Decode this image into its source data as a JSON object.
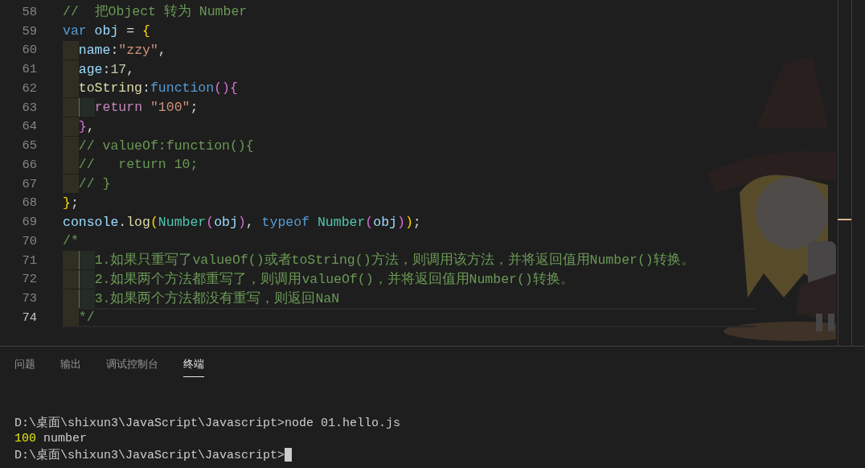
{
  "editor": {
    "lines": [
      {
        "number": "58",
        "current": false,
        "tokens": [
          {
            "kind": "comment",
            "text": "//  把Object 转为 Number"
          }
        ]
      },
      {
        "number": "59",
        "current": false,
        "tokens": [
          {
            "kind": "keyword",
            "text": "var"
          },
          {
            "kind": "variable",
            "text": " obj"
          },
          {
            "kind": "plain",
            "text": " = "
          },
          {
            "kind": "bracket1",
            "text": "{"
          }
        ]
      },
      {
        "number": "60",
        "current": false,
        "tokens": [
          {
            "kind": "variable",
            "text": "  name"
          },
          {
            "kind": "plain",
            "text": ":"
          },
          {
            "kind": "string",
            "text": "\"zzy\""
          },
          {
            "kind": "plain",
            "text": ","
          }
        ]
      },
      {
        "number": "61",
        "current": false,
        "tokens": [
          {
            "kind": "variable",
            "text": "  age"
          },
          {
            "kind": "plain",
            "text": ":"
          },
          {
            "kind": "number",
            "text": "17"
          },
          {
            "kind": "plain",
            "text": ","
          }
        ]
      },
      {
        "number": "62",
        "current": false,
        "tokens": [
          {
            "kind": "function",
            "text": "  toString"
          },
          {
            "kind": "plain",
            "text": ":"
          },
          {
            "kind": "keyword",
            "text": "function"
          },
          {
            "kind": "bracket2",
            "text": "(){"
          }
        ]
      },
      {
        "number": "63",
        "current": false,
        "tokens": [
          {
            "kind": "control",
            "text": "    return "
          },
          {
            "kind": "string",
            "text": "\"100\""
          },
          {
            "kind": "plain",
            "text": ";"
          }
        ]
      },
      {
        "number": "64",
        "current": false,
        "tokens": [
          {
            "kind": "bracket2",
            "text": "  }"
          },
          {
            "kind": "plain",
            "text": ","
          }
        ]
      },
      {
        "number": "65",
        "current": false,
        "tokens": [
          {
            "kind": "comment",
            "text": "  // valueOf:function(){"
          }
        ]
      },
      {
        "number": "66",
        "current": false,
        "tokens": [
          {
            "kind": "comment",
            "text": "  //   return 10;"
          }
        ]
      },
      {
        "number": "67",
        "current": false,
        "tokens": [
          {
            "kind": "comment",
            "text": "  // }"
          }
        ]
      },
      {
        "number": "68",
        "current": false,
        "tokens": [
          {
            "kind": "bracket1",
            "text": "}"
          },
          {
            "kind": "plain",
            "text": ";"
          }
        ]
      },
      {
        "number": "69",
        "current": false,
        "tokens": [
          {
            "kind": "variable",
            "text": "console"
          },
          {
            "kind": "plain",
            "text": "."
          },
          {
            "kind": "function",
            "text": "log"
          },
          {
            "kind": "bracket1",
            "text": "("
          },
          {
            "kind": "class",
            "text": "Number"
          },
          {
            "kind": "bracket2",
            "text": "("
          },
          {
            "kind": "variable",
            "text": "obj"
          },
          {
            "kind": "bracket2",
            "text": ")"
          },
          {
            "kind": "plain",
            "text": ", "
          },
          {
            "kind": "keyword",
            "text": "typeof"
          },
          {
            "kind": "class",
            "text": " Number"
          },
          {
            "kind": "bracket2",
            "text": "("
          },
          {
            "kind": "variable",
            "text": "obj"
          },
          {
            "kind": "bracket2",
            "text": ")"
          },
          {
            "kind": "bracket1",
            "text": ")"
          },
          {
            "kind": "plain",
            "text": ";"
          }
        ]
      },
      {
        "number": "70",
        "current": false,
        "tokens": [
          {
            "kind": "comment",
            "text": "/*"
          }
        ]
      },
      {
        "number": "71",
        "current": false,
        "tokens": [
          {
            "kind": "comment",
            "text": "    1.如果只重写了valueOf()或者toString()方法，则调用该方法，并将返回值用Number()转换。"
          }
        ]
      },
      {
        "number": "72",
        "current": false,
        "tokens": [
          {
            "kind": "comment",
            "text": "    2.如果两个方法都重写了，则调用valueOf()，并将返回值用Number()转换。"
          }
        ]
      },
      {
        "number": "73",
        "current": false,
        "tokens": [
          {
            "kind": "comment",
            "text": "    3.如果两个方法都没有重写，则返回NaN"
          }
        ]
      },
      {
        "number": "74",
        "current": true,
        "tokens": [
          {
            "kind": "comment",
            "text": "  */"
          }
        ]
      }
    ]
  },
  "panel": {
    "tabs": [
      {
        "label": "问题",
        "selected": false
      },
      {
        "label": "输出",
        "selected": false
      },
      {
        "label": "调试控制台",
        "selected": false
      },
      {
        "label": "终端",
        "selected": true
      }
    ],
    "terminal": [
      {
        "segments": [
          {
            "kind": "plain",
            "text": "D:\\桌面\\shixun3\\JavaScript\\Javascript>node 01.hello.js"
          }
        ]
      },
      {
        "segments": [
          {
            "kind": "number",
            "text": "100"
          },
          {
            "kind": "plain",
            "text": " number"
          }
        ]
      },
      {
        "segments": [
          {
            "kind": "plain",
            "text": "D:\\桌面\\shixun3\\JavaScript\\Javascript>"
          }
        ],
        "cursor": true
      }
    ]
  }
}
